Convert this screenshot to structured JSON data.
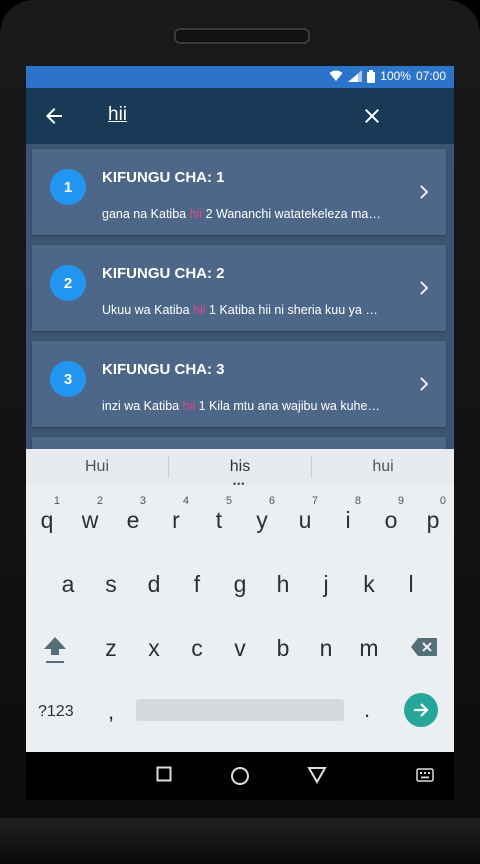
{
  "status": {
    "battery": "100%",
    "time": "07:00"
  },
  "appbar": {
    "query": "hii"
  },
  "results": [
    {
      "num": "1",
      "title": "KIFUNGU CHA: 1",
      "pre": "gana na Katiba ",
      "hl": "hii",
      "post": "   2 Wananchi watatekeleza ma…"
    },
    {
      "num": "2",
      "title": "KIFUNGU CHA: 2",
      "pre": "Ukuu wa Katiba ",
      "hl": "hii",
      "post": "   1  Katiba hii ni sheria kuu ya …"
    },
    {
      "num": "3",
      "title": "KIFUNGU CHA: 3",
      "pre": "inzi wa Katiba ",
      "hl": "hii",
      "post": "   1  Kila mtu ana wajibu wa kuhe…"
    }
  ],
  "keyboard": {
    "suggestions": [
      "Hui",
      "his",
      "hui"
    ],
    "row1": [
      "q",
      "w",
      "e",
      "r",
      "t",
      "y",
      "u",
      "i",
      "o",
      "p"
    ],
    "row1_sup": [
      "1",
      "2",
      "3",
      "4",
      "5",
      "6",
      "7",
      "8",
      "9",
      "0"
    ],
    "row2": [
      "a",
      "s",
      "d",
      "f",
      "g",
      "h",
      "j",
      "k",
      "l"
    ],
    "row3": [
      "z",
      "x",
      "c",
      "v",
      "b",
      "n",
      "m"
    ],
    "symbols_label": "?123",
    "comma": ",",
    "period": "."
  }
}
